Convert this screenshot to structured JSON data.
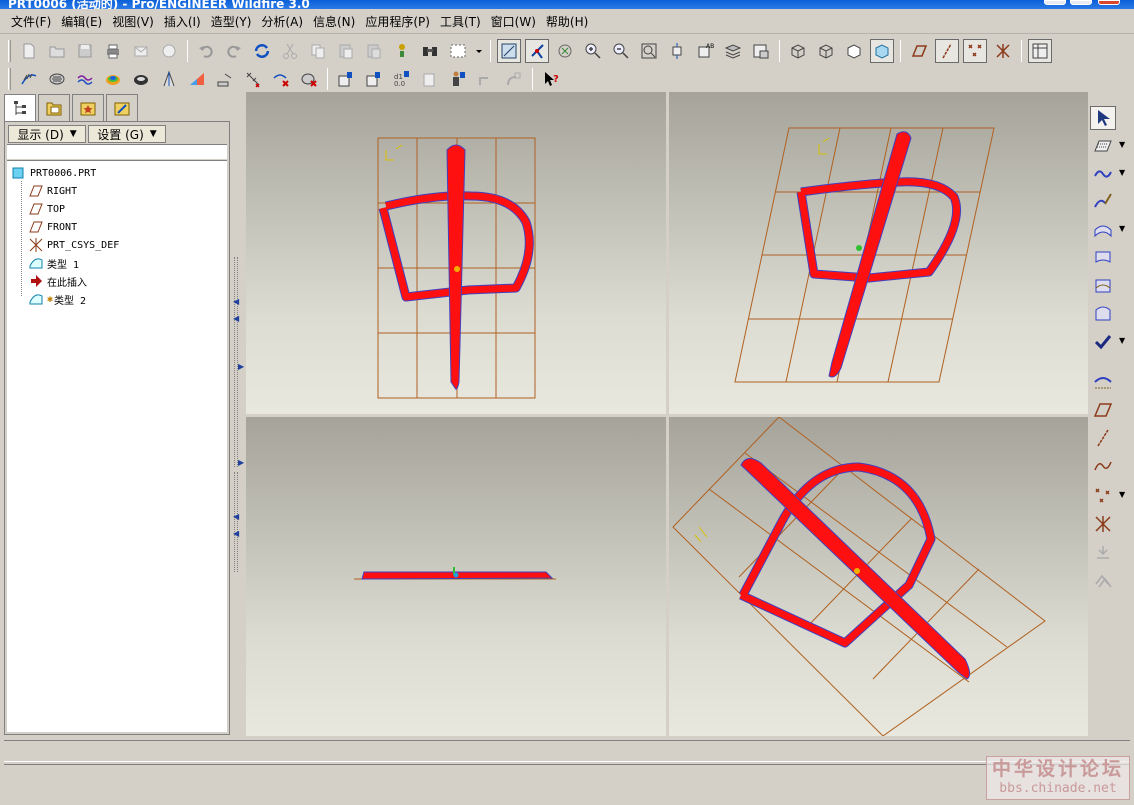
{
  "window": {
    "title": "PRT0006 (活动的) - Pro/ENGINEER Wildfire 3.0"
  },
  "menu": [
    "文件(F)",
    "编辑(E)",
    "视图(V)",
    "插入(I)",
    "造型(Y)",
    "分析(A)",
    "信息(N)",
    "应用程序(P)",
    "工具(T)",
    "窗口(W)",
    "帮助(H)"
  ],
  "nav_tabs": [
    {
      "icon": "model-tree-icon"
    },
    {
      "icon": "folder-browser-icon"
    },
    {
      "icon": "favorites-icon"
    },
    {
      "icon": "connections-icon"
    }
  ],
  "model_tree": {
    "show_button": "显示 (D)",
    "settings_button": "设置 (G)",
    "items": [
      {
        "label": "PRT0006.PRT",
        "icon": "part-icon"
      },
      {
        "label": "RIGHT",
        "icon": "datum-plane-icon"
      },
      {
        "label": "TOP",
        "icon": "datum-plane-icon"
      },
      {
        "label": "FRONT",
        "icon": "datum-plane-icon"
      },
      {
        "label": "PRT_CSYS_DEF",
        "icon": "coordinate-system-icon"
      },
      {
        "label": "类型 1",
        "icon": "style-feature-icon"
      },
      {
        "label": "在此插入",
        "icon": "insert-here-arrow-icon"
      },
      {
        "label": "类型 2",
        "icon": "style-feature-icon"
      }
    ]
  },
  "viewports": [
    {
      "name": "top-left",
      "view": "front"
    },
    {
      "name": "top-right",
      "view": "isometric"
    },
    {
      "name": "bottom-left",
      "view": "top"
    },
    {
      "name": "bottom-right",
      "view": "rotated"
    }
  ],
  "watermark": {
    "line1": "中华设计论坛",
    "line2": "bbs.chinade.net"
  },
  "colors": {
    "curve": "#ff1010",
    "curve_edge": "#4040c0",
    "grid": "#b06020",
    "background_top": "#a6a49a",
    "background_bottom": "#e8e8de"
  }
}
